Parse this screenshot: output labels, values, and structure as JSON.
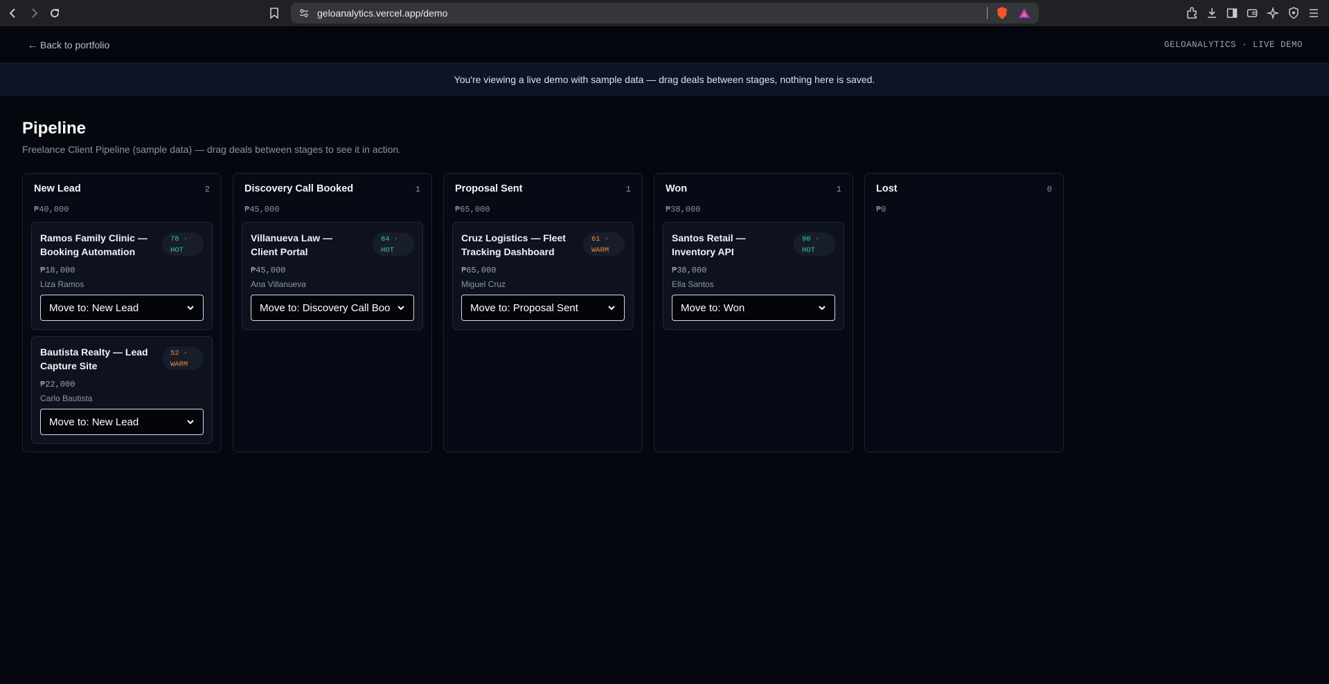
{
  "browser": {
    "url": "geloanalytics.vercel.app/demo"
  },
  "header": {
    "back_label": "← Back to portfolio",
    "brand": "GELOANALYTICS · LIVE DEMO"
  },
  "banner": {
    "text": "You're viewing a live demo with sample data — drag deals between stages, nothing here is saved."
  },
  "page": {
    "title": "Pipeline",
    "subtitle": "Freelance Client Pipeline (sample data) — drag deals between stages to see it in action."
  },
  "colors": {
    "hot": "#36d27a",
    "warm": "#f08a2e",
    "background": "#05070f"
  },
  "columns": [
    {
      "title": "New Lead",
      "count": "2",
      "total": "₱40,000",
      "cards": [
        {
          "title": "Ramos Family Clinic — Booking Automation",
          "score": "78 ·",
          "temp": "HOT",
          "value": "₱18,000",
          "contact": "Liza Ramos",
          "move": "Move to: New Lead"
        },
        {
          "title": "Bautista Realty — Lead Capture Site",
          "score": "52 ·",
          "temp": "WARM",
          "value": "₱22,000",
          "contact": "Carlo Bautista",
          "move": "Move to: New Lead"
        }
      ]
    },
    {
      "title": "Discovery Call Booked",
      "count": "1",
      "total": "₱45,000",
      "cards": [
        {
          "title": "Villanueva Law — Client Portal",
          "score": "84 ·",
          "temp": "HOT",
          "value": "₱45,000",
          "contact": "Ana Villanueva",
          "move": "Move to: Discovery Call Boo"
        }
      ]
    },
    {
      "title": "Proposal Sent",
      "count": "1",
      "total": "₱65,000",
      "cards": [
        {
          "title": "Cruz Logistics — Fleet Tracking Dashboard",
          "score": "61 ·",
          "temp": "WARM",
          "value": "₱65,000",
          "contact": "Miguel Cruz",
          "move": "Move to: Proposal Sent"
        }
      ]
    },
    {
      "title": "Won",
      "count": "1",
      "total": "₱38,000",
      "cards": [
        {
          "title": "Santos Retail — Inventory API",
          "score": "90 ·",
          "temp": "HOT",
          "value": "₱38,000",
          "contact": "Ella Santos",
          "move": "Move to: Won"
        }
      ]
    },
    {
      "title": "Lost",
      "count": "0",
      "total": "₱0",
      "cards": []
    }
  ]
}
